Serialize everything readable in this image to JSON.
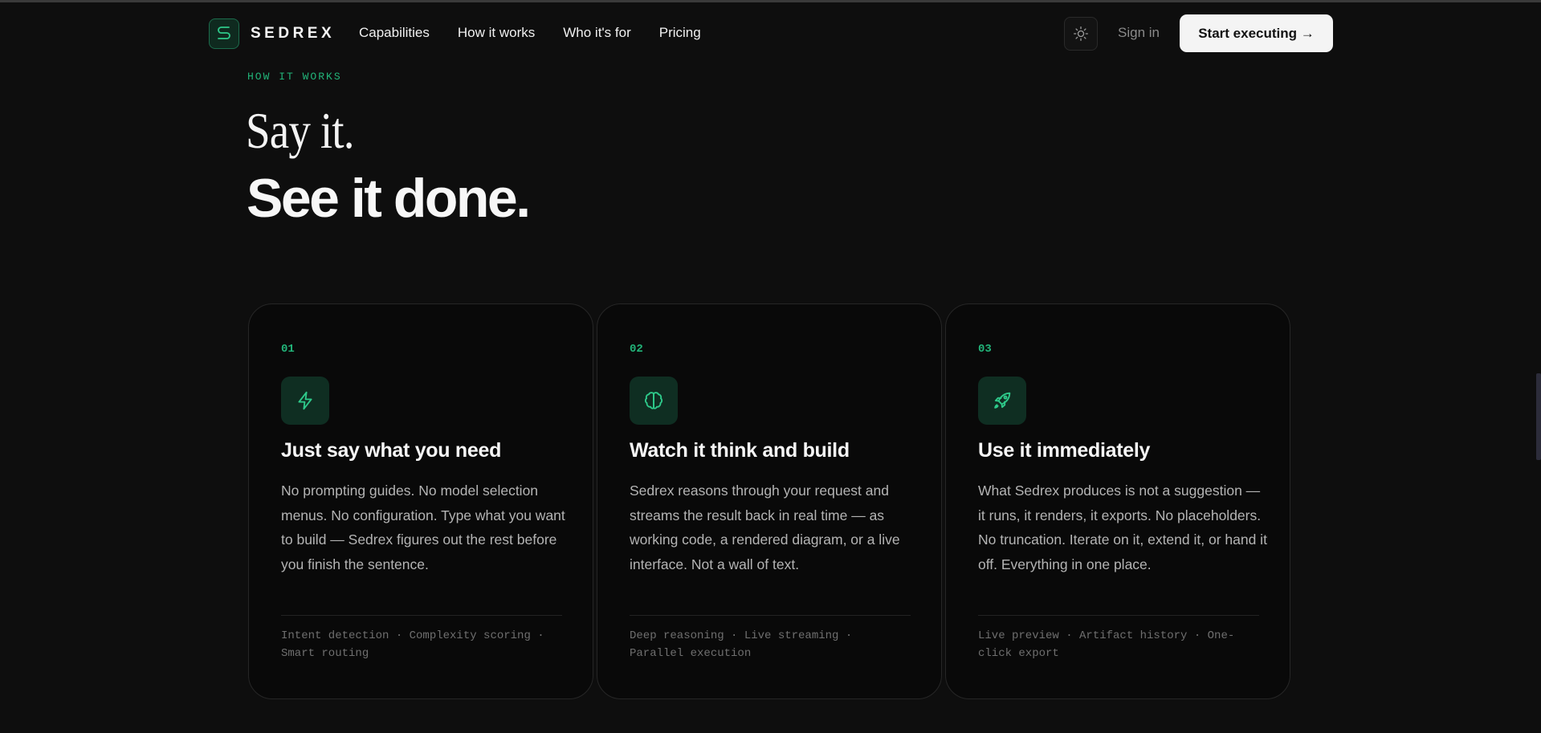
{
  "nav": {
    "brand": "SEDREX",
    "links": [
      "Capabilities",
      "How it works",
      "Who it's for",
      "Pricing"
    ],
    "sign_in": "Sign in",
    "cta": "Start executing →"
  },
  "hero": {
    "eyebrow": "HOW IT WORKS",
    "line1": "Say it.",
    "line2": "See it done."
  },
  "cards": [
    {
      "num": "01",
      "icon": "lightning-icon",
      "title": "Just say what you need",
      "body": "No prompting guides. No model selection menus. No configuration. Type what you want to build — Sedrex figures out the rest before you finish the sentence.",
      "tags": "Intent detection · Complexity scoring · Smart routing"
    },
    {
      "num": "02",
      "icon": "brain-icon",
      "title": "Watch it think and build",
      "body": "Sedrex reasons through your request and streams the result back in real time — as working code, a rendered diagram, or a live interface. Not a wall of text.",
      "tags": "Deep reasoning · Live streaming · Parallel execution"
    },
    {
      "num": "03",
      "icon": "rocket-icon",
      "title": "Use it immediately",
      "body": "What Sedrex produces is not a suggestion — it runs, it renders, it exports. No placeholders. No truncation. Iterate on it, extend it, or hand it off. Everything in one place.",
      "tags": "Live preview · Artifact history · One-click export"
    }
  ],
  "colors": {
    "background": "#0e0e0e",
    "card": "#090909",
    "accent": "#22b57a",
    "icon_tile": "#0f2e22"
  }
}
